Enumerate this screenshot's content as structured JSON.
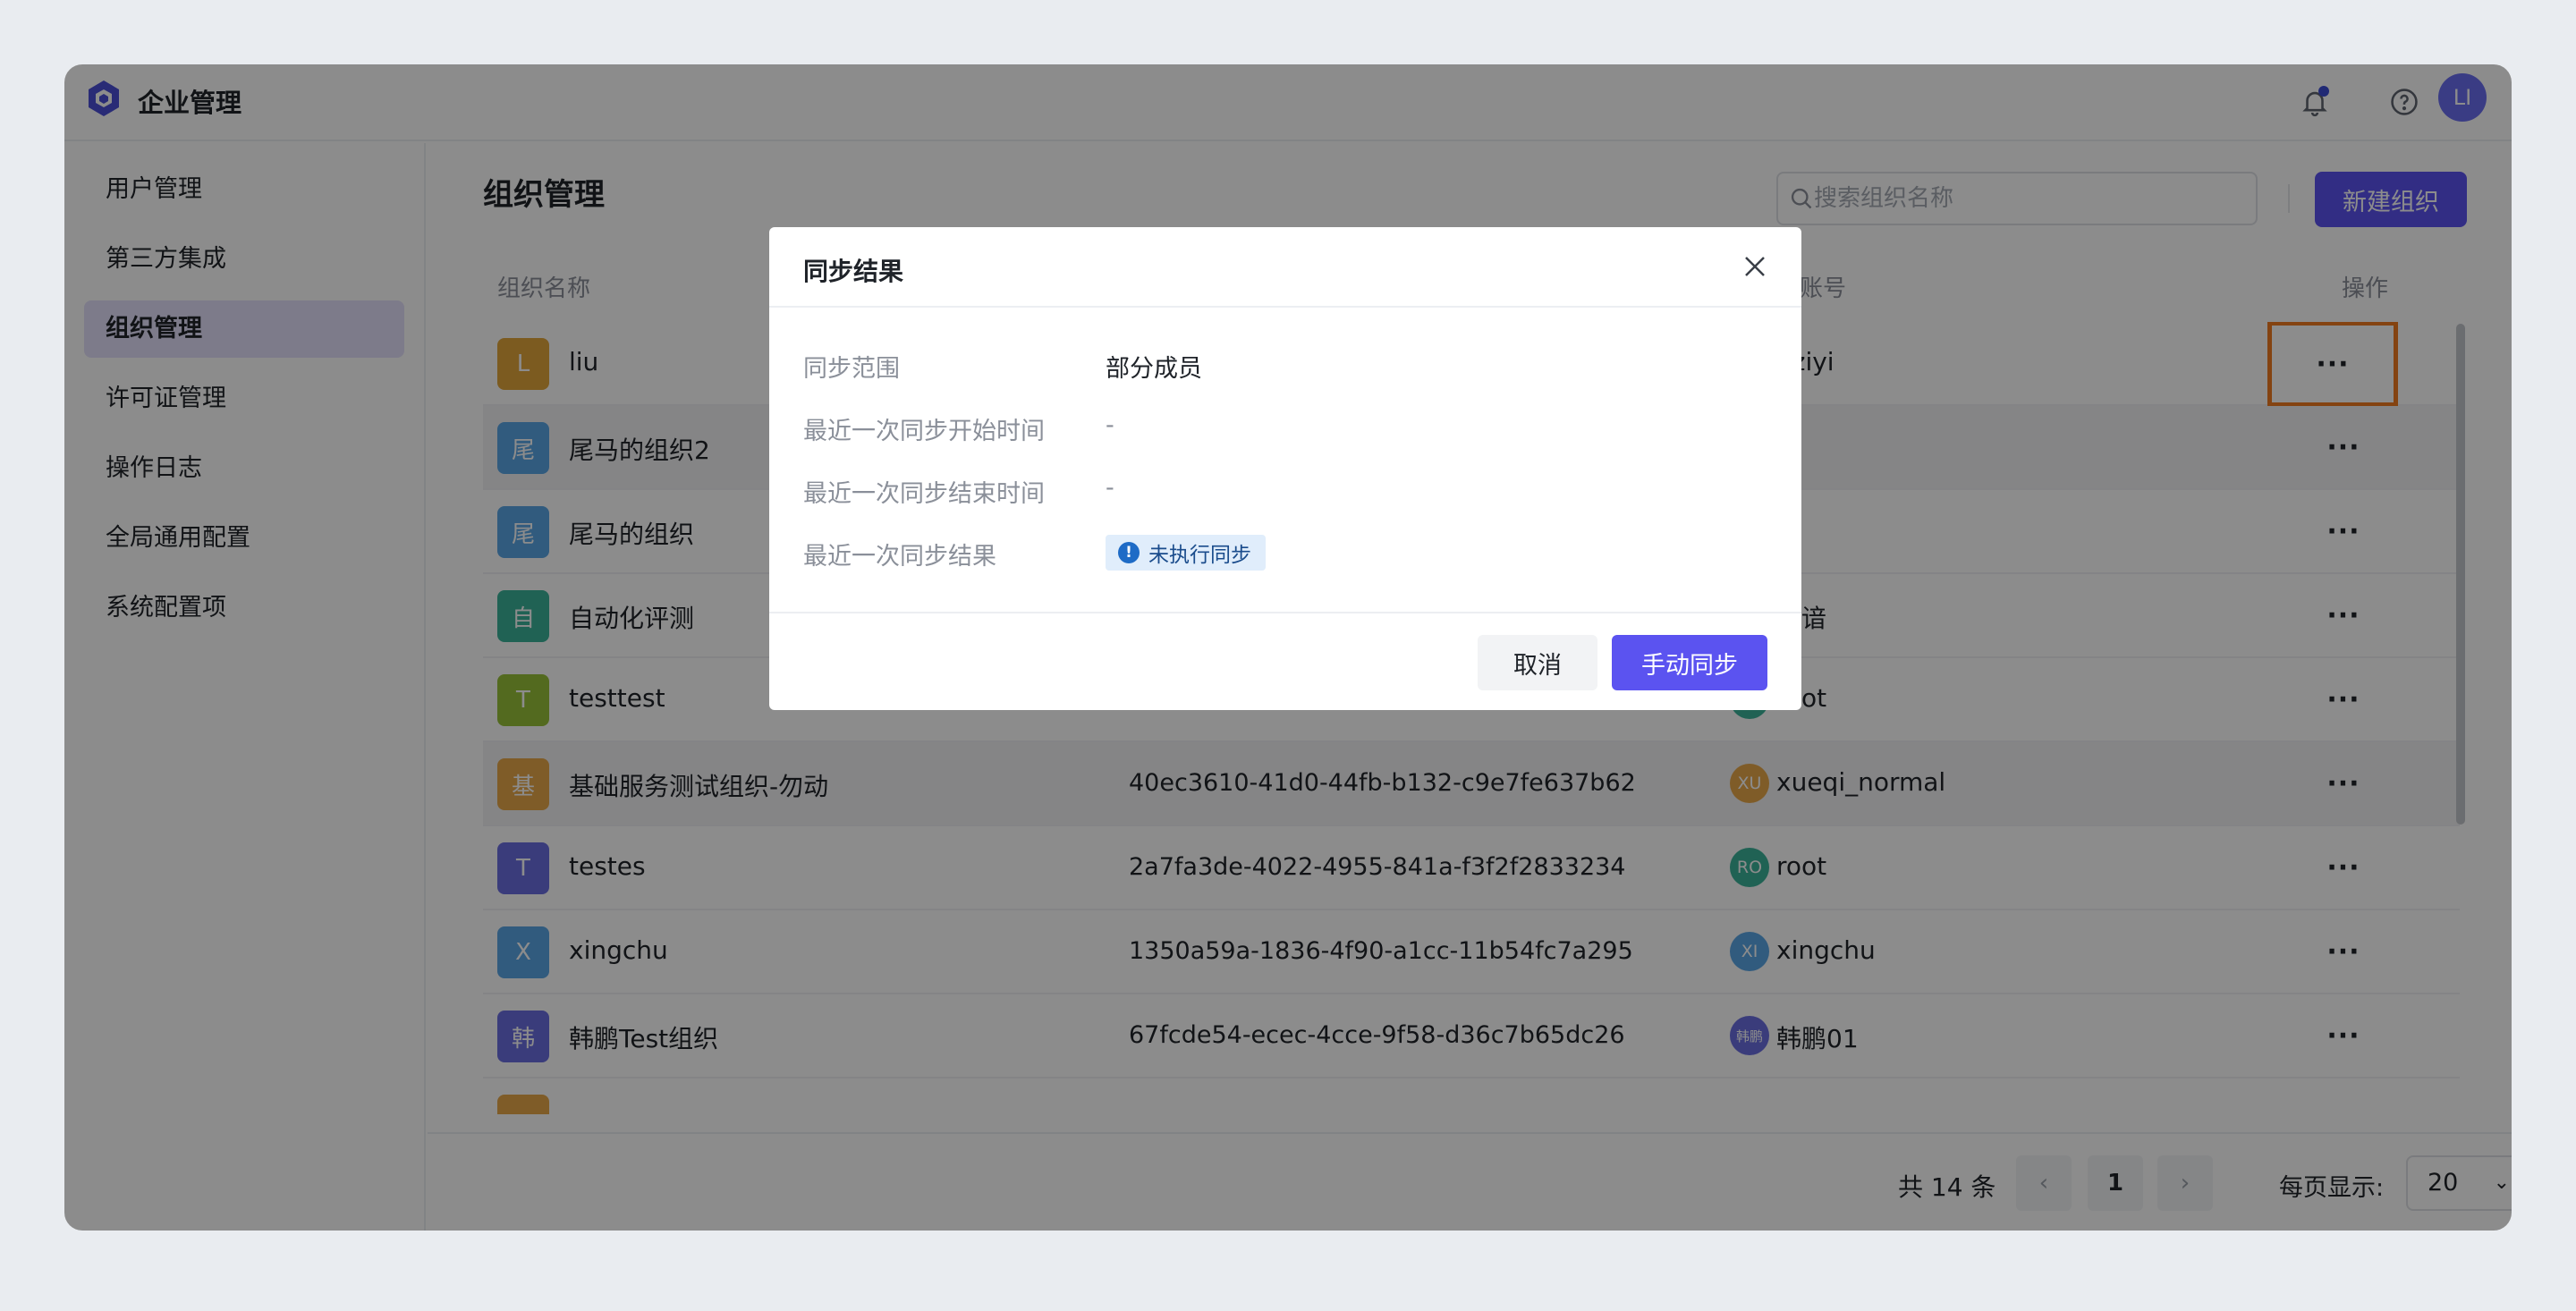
{
  "app": {
    "title": "企业管理",
    "user_initials": "LI"
  },
  "sidebar": {
    "items": [
      {
        "label": "用户管理",
        "active": false
      },
      {
        "label": "第三方集成",
        "active": false
      },
      {
        "label": "组织管理",
        "active": true
      },
      {
        "label": "许可证管理",
        "active": false
      },
      {
        "label": "操作日志",
        "active": false
      },
      {
        "label": "全局通用配置",
        "active": false
      },
      {
        "label": "系统配置项",
        "active": false
      }
    ]
  },
  "main": {
    "title": "组织管理",
    "search_placeholder": "搜索组织名称",
    "new_button": "新建组织",
    "columns": {
      "name": "组织名称",
      "owner": "拥有者账号",
      "actions": "操作"
    },
    "rows": [
      {
        "initial": "L",
        "color": "#e2a63b",
        "name": "liu",
        "id": "",
        "owner_initials": "",
        "owner_color": "",
        "owner": "uziyi"
      },
      {
        "initial": "尾",
        "color": "#5aa6e6",
        "name": "尾马的组织2",
        "id": "",
        "owner_initials": "",
        "owner_color": "",
        "owner": ""
      },
      {
        "initial": "尾",
        "color": "#5aa6e6",
        "name": "尾马的组织",
        "id": "",
        "owner_initials": "",
        "owner_color": "",
        "owner": ""
      },
      {
        "initial": "自",
        "color": "#3bb39a",
        "name": "自动化评测",
        "id": "",
        "owner_initials": "",
        "owner_color": "",
        "owner": "菽谙"
      },
      {
        "initial": "T",
        "color": "#98c23a",
        "name": "testtest",
        "id": "",
        "owner_initials": "",
        "owner_color": "#3bb39a",
        "owner": "root"
      },
      {
        "initial": "基",
        "color": "#e8a84a",
        "name": "基础服务测试组织-勿动",
        "id": "40ec3610-41d0-44fb-b132-c9e7fe637b62",
        "owner_initials": "XU",
        "owner_color": "#e8a84a",
        "owner": "xueqi_normal"
      },
      {
        "initial": "T",
        "color": "#6a6ee0",
        "name": "testes",
        "id": "2a7fa3de-4022-4955-841a-f3f2f2833234",
        "owner_initials": "RO",
        "owner_color": "#3bb39a",
        "owner": "root"
      },
      {
        "initial": "X",
        "color": "#5aa6e6",
        "name": "xingchu",
        "id": "1350a59a-1836-4f90-a1cc-11b54fc7a295",
        "owner_initials": "XI",
        "owner_color": "#5aa6e6",
        "owner": "xingchu"
      },
      {
        "initial": "韩",
        "color": "#6a6ee0",
        "name": "韩鹏Test组织",
        "id": "67fcde54-ecec-4cce-9f58-d36c7b65dc26",
        "owner_initials": "韩鹏",
        "owner_color": "#6a6ee0",
        "owner": "韩鹏01"
      }
    ]
  },
  "pagination": {
    "total": "共 14 条",
    "current_page": "1",
    "per_page_label": "每页显示:",
    "per_page": "20"
  },
  "modal": {
    "title": "同步结果",
    "fields": [
      {
        "key": "同步范围",
        "value": "部分成员"
      },
      {
        "key": "最近一次同步开始时间",
        "value": "-"
      },
      {
        "key": "最近一次同步结束时间",
        "value": "-"
      },
      {
        "key": "最近一次同步结果",
        "value": ""
      }
    ],
    "status_tag": "未执行同步",
    "cancel": "取消",
    "confirm": "手动同步"
  },
  "colors": {
    "primary": "#5b53f0",
    "focus_outline": "#f07b1f",
    "status_blue": "#1e6bc6"
  }
}
